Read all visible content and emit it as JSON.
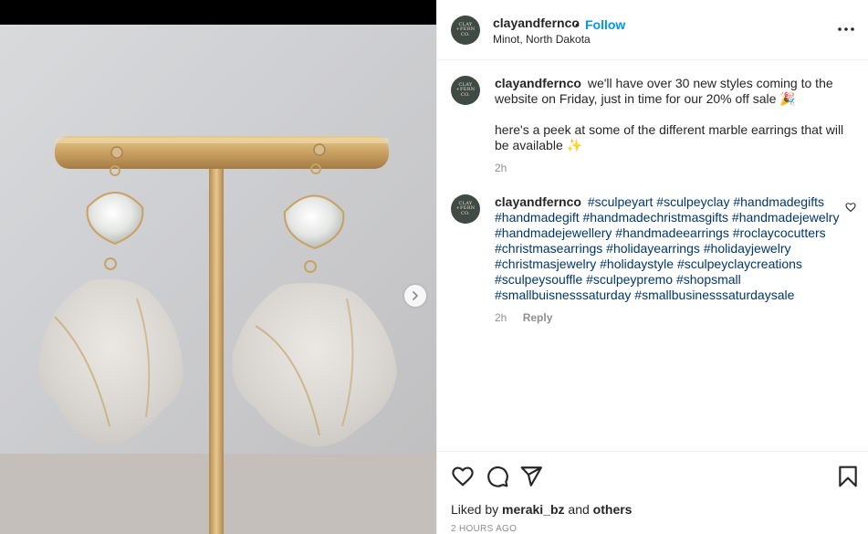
{
  "post": {
    "username": "clayandfernco",
    "follow_label": "Follow",
    "separator": "•",
    "location": "Minot, North Dakota",
    "avatar_text": [
      "CLAY",
      "+FERN",
      "CO."
    ]
  },
  "caption": {
    "username": "clayandfernco",
    "text_line1": "we'll have over 30 new styles coming to the website on Friday, just in time for our 20% off sale 🎉",
    "text_line2": "here's a peek at some of the different marble earrings that will be available ✨",
    "time": "2h"
  },
  "comment": {
    "username": "clayandfernco",
    "hashtags": "#sculpeyart #sculpeyclay #handmadegifts #handmadegift #handmadechristmasgifts #handmadejewelry #handmadejewellery #handmadeearrings #roclaycocutters #christmasearrings #holidayearrings #holidayjewelry #christmasjewelry #holidaystyle #sculpeyclaycreations #sculpeysouffle #sculpeypremo #shopsmall #smallbuisnesssaturday #smallbusinesssaturdaysale",
    "time": "2h",
    "reply_label": "Reply"
  },
  "footer": {
    "liked_prefix": "Liked by",
    "liked_user": "meraki_bz",
    "liked_and": "and",
    "liked_others": "others",
    "time_ago": "2 HOURS AGO"
  },
  "icons": {
    "like": "heart-icon",
    "comment": "comment-icon",
    "share": "paper-plane-icon",
    "save": "bookmark-icon",
    "more": "more-dots-icon",
    "next": "chevron-right-icon"
  },
  "colors": {
    "follow": "#0095f6",
    "hashtag": "#00376b",
    "muted": "#8e8e8e",
    "avatar_bg": "#3f4a44"
  }
}
